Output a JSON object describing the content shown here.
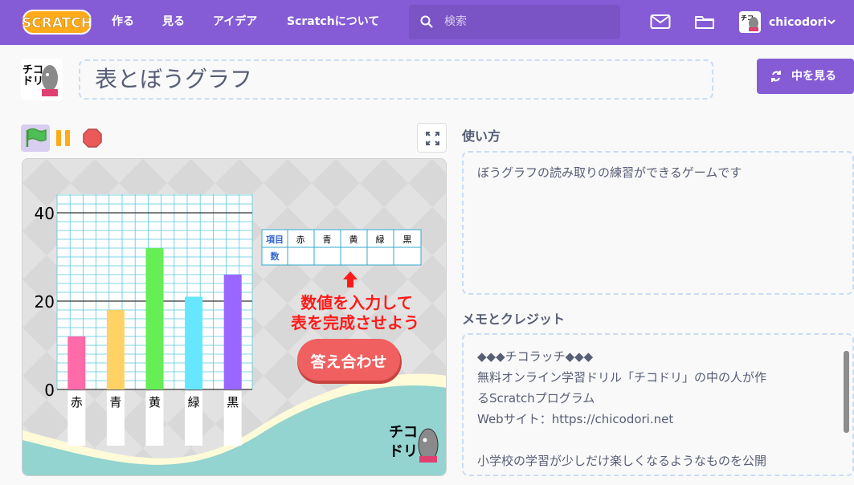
{
  "navbar": {
    "logo_text": "SCRATCH",
    "links": [
      "作る",
      "見る",
      "アイデア",
      "Scratchについて"
    ],
    "search_placeholder": "検索",
    "username": "chicodori"
  },
  "project": {
    "title": "表とぼうグラフ",
    "see_inside_label": "中を見る"
  },
  "stage": {
    "y_axis_ticks": [
      "40",
      "20",
      "0"
    ],
    "categories": [
      "赤",
      "青",
      "黄",
      "緑",
      "黒"
    ],
    "values": [
      12,
      18,
      32,
      21,
      26
    ],
    "ymax": 40,
    "bar_colors": [
      "#ff6aa8",
      "#ffd266",
      "#66ee55",
      "#66e6ff",
      "#9966ff"
    ],
    "table_header": "項目",
    "table_row_label": "数",
    "table_cols": [
      "赤",
      "青",
      "黄",
      "緑",
      "黒"
    ],
    "instruction_line1": "数値を入力して",
    "instruction_line2": "表を完成させよう",
    "check_button": "答え合わせ",
    "logo_line1": "チコ",
    "logo_line2": "ドリ"
  },
  "instructions": {
    "title": "使い方",
    "text": "ぼうグラフの読み取りの練習ができるゲームです"
  },
  "notes": {
    "title": "メモとクレジット",
    "lines": [
      "◆◆◆チコラッチ◆◆◆",
      "無料オンライン学習ドリル「チコドリ」の中の人が作",
      "るScratchプログラム",
      "Webサイト：https://chicodori.net",
      "",
      "小学校の学習が少しだけ楽しくなるようなものを公開"
    ]
  }
}
